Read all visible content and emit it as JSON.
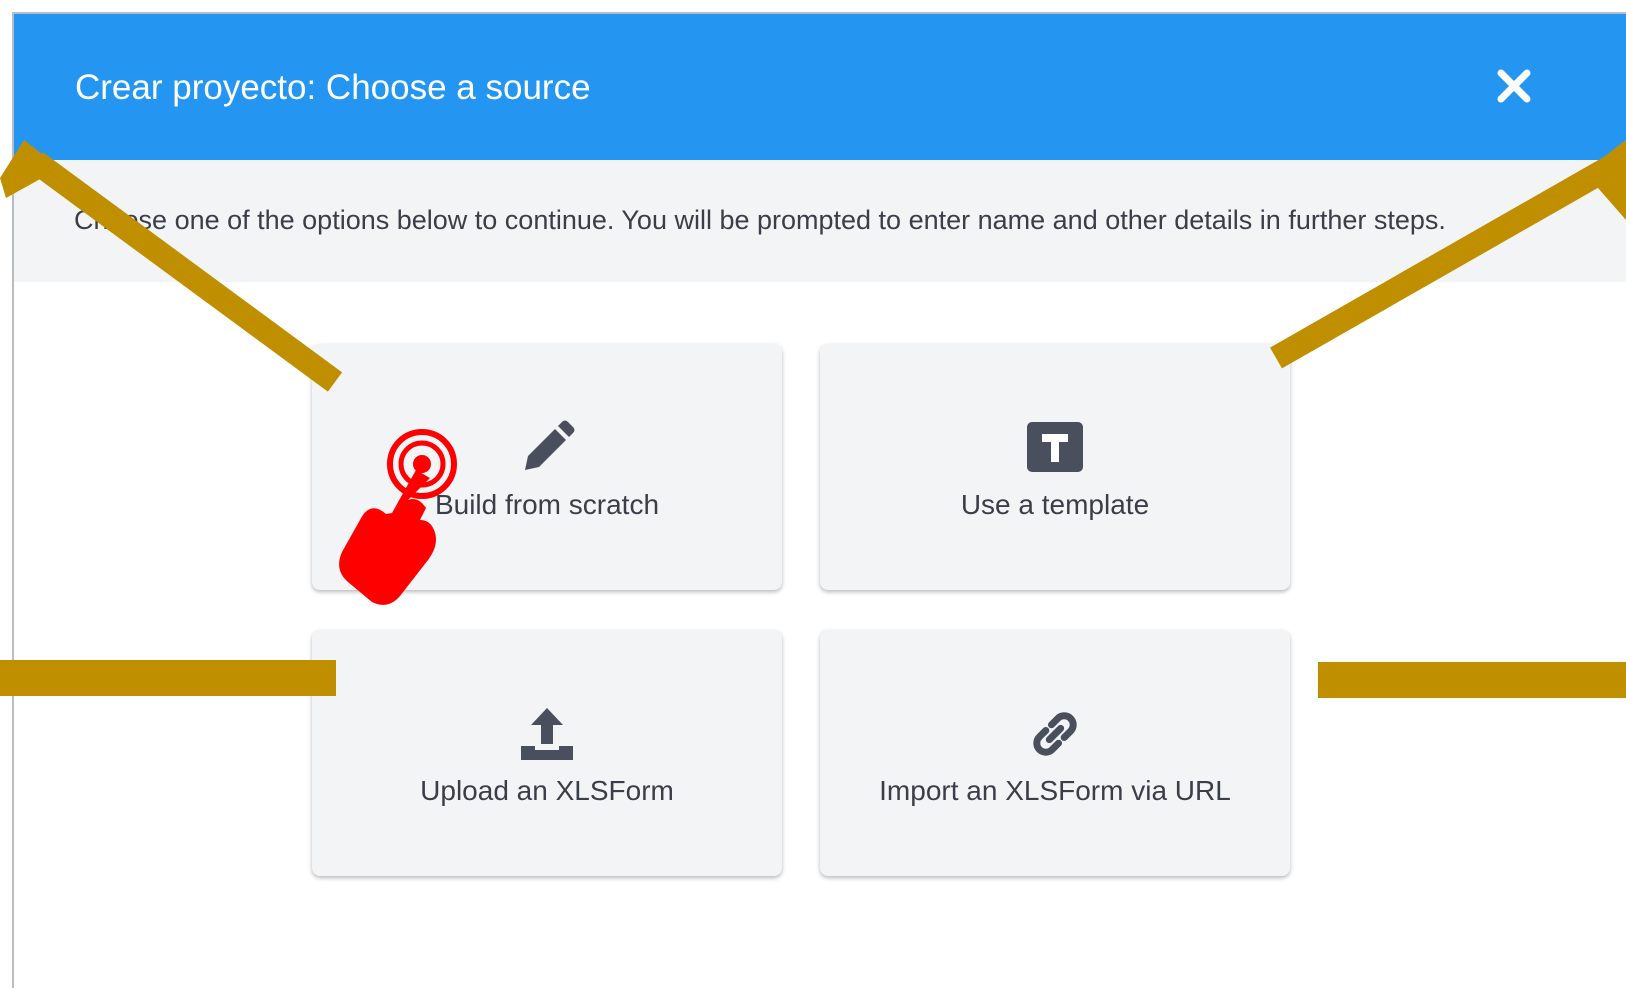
{
  "dialog": {
    "title": "Crear proyecto: Choose a source",
    "close_icon": "close-icon",
    "instructions": "Choose one of the options below to continue. You will be prompted to enter name and other details in further steps."
  },
  "options": [
    {
      "label": "Build from scratch",
      "icon": "pencil-icon"
    },
    {
      "label": "Use a template",
      "icon": "template-icon"
    },
    {
      "label": "Upload an XLSForm",
      "icon": "upload-icon"
    },
    {
      "label": "Import an XLSForm via URL",
      "icon": "link-icon"
    }
  ],
  "annotations": {
    "arrow_color": "#bf8f00",
    "pointer_color": "#ff0000",
    "pointer_icon": "tap-hand-icon"
  },
  "colors": {
    "header": "#2496f2",
    "info_strip": "#f3f4f6",
    "card": "#f3f4f6",
    "text": "#3a3e48",
    "icon": "#4a4f5e"
  }
}
